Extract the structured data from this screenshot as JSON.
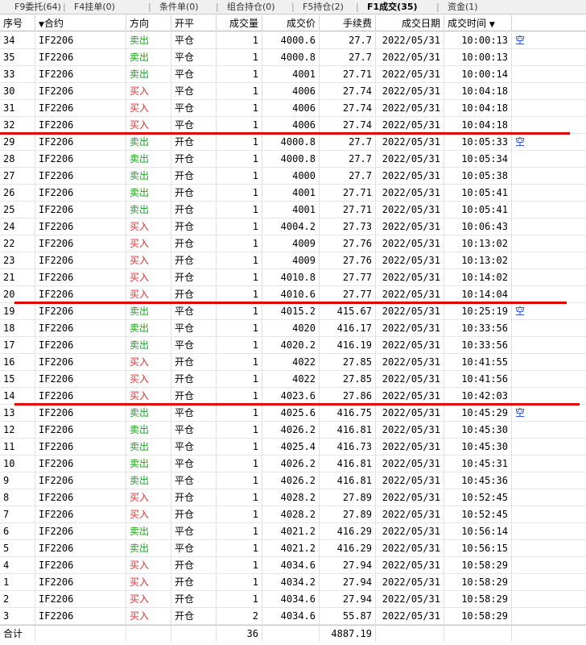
{
  "tabs": [
    {
      "label": "F9委托(64)"
    },
    {
      "label": "F4挂单(0)"
    },
    {
      "label": "条件单(0)"
    },
    {
      "label": "组合持仓(0)"
    },
    {
      "label": "F5持仓(2)"
    },
    {
      "label": "F1成交(35)",
      "active": true
    },
    {
      "label": "资金(1)"
    }
  ],
  "header": {
    "seq": "序号",
    "contract": "合约",
    "dir": "方向",
    "open": "开平",
    "qty": "成交量",
    "price": "成交价",
    "fee": "手续费",
    "date": "成交日期",
    "time": "成交时间"
  },
  "rows": [
    {
      "seq": "34",
      "contract": "IF2206",
      "dir": "卖出",
      "open": "平仓",
      "qty": "1",
      "price": "4000.6",
      "fee": "27.7",
      "date": "2022/05/31",
      "time": "10:00:13",
      "note": "空"
    },
    {
      "seq": "35",
      "contract": "IF2206",
      "dir": "卖出",
      "open": "平仓",
      "qty": "1",
      "price": "4000.8",
      "fee": "27.7",
      "date": "2022/05/31",
      "time": "10:00:13",
      "note": ""
    },
    {
      "seq": "33",
      "contract": "IF2206",
      "dir": "卖出",
      "open": "平仓",
      "qty": "1",
      "price": "4001",
      "fee": "27.71",
      "date": "2022/05/31",
      "time": "10:00:14",
      "note": ""
    },
    {
      "seq": "30",
      "contract": "IF2206",
      "dir": "买入",
      "open": "平仓",
      "qty": "1",
      "price": "4006",
      "fee": "27.74",
      "date": "2022/05/31",
      "time": "10:04:18",
      "note": ""
    },
    {
      "seq": "31",
      "contract": "IF2206",
      "dir": "买入",
      "open": "平仓",
      "qty": "1",
      "price": "4006",
      "fee": "27.74",
      "date": "2022/05/31",
      "time": "10:04:18",
      "note": ""
    },
    {
      "seq": "32",
      "contract": "IF2206",
      "dir": "买入",
      "open": "平仓",
      "qty": "1",
      "price": "4006",
      "fee": "27.74",
      "date": "2022/05/31",
      "time": "10:04:18",
      "note": ""
    },
    {
      "seq": "29",
      "contract": "IF2206",
      "dir": "卖出",
      "open": "开仓",
      "qty": "1",
      "price": "4000.8",
      "fee": "27.7",
      "date": "2022/05/31",
      "time": "10:05:33",
      "note": "空"
    },
    {
      "seq": "28",
      "contract": "IF2206",
      "dir": "卖出",
      "open": "开仓",
      "qty": "1",
      "price": "4000.8",
      "fee": "27.7",
      "date": "2022/05/31",
      "time": "10:05:34",
      "note": ""
    },
    {
      "seq": "27",
      "contract": "IF2206",
      "dir": "卖出",
      "open": "开仓",
      "qty": "1",
      "price": "4000",
      "fee": "27.7",
      "date": "2022/05/31",
      "time": "10:05:38",
      "note": ""
    },
    {
      "seq": "26",
      "contract": "IF2206",
      "dir": "卖出",
      "open": "开仓",
      "qty": "1",
      "price": "4001",
      "fee": "27.71",
      "date": "2022/05/31",
      "time": "10:05:41",
      "note": ""
    },
    {
      "seq": "25",
      "contract": "IF2206",
      "dir": "卖出",
      "open": "开仓",
      "qty": "1",
      "price": "4001",
      "fee": "27.71",
      "date": "2022/05/31",
      "time": "10:05:41",
      "note": ""
    },
    {
      "seq": "24",
      "contract": "IF2206",
      "dir": "买入",
      "open": "开仓",
      "qty": "1",
      "price": "4004.2",
      "fee": "27.73",
      "date": "2022/05/31",
      "time": "10:06:43",
      "note": ""
    },
    {
      "seq": "22",
      "contract": "IF2206",
      "dir": "买入",
      "open": "开仓",
      "qty": "1",
      "price": "4009",
      "fee": "27.76",
      "date": "2022/05/31",
      "time": "10:13:02",
      "note": ""
    },
    {
      "seq": "23",
      "contract": "IF2206",
      "dir": "买入",
      "open": "开仓",
      "qty": "1",
      "price": "4009",
      "fee": "27.76",
      "date": "2022/05/31",
      "time": "10:13:02",
      "note": ""
    },
    {
      "seq": "21",
      "contract": "IF2206",
      "dir": "买入",
      "open": "开仓",
      "qty": "1",
      "price": "4010.8",
      "fee": "27.77",
      "date": "2022/05/31",
      "time": "10:14:02",
      "note": ""
    },
    {
      "seq": "20",
      "contract": "IF2206",
      "dir": "买入",
      "open": "开仓",
      "qty": "1",
      "price": "4010.6",
      "fee": "27.77",
      "date": "2022/05/31",
      "time": "10:14:04",
      "note": ""
    },
    {
      "seq": "19",
      "contract": "IF2206",
      "dir": "卖出",
      "open": "平仓",
      "qty": "1",
      "price": "4015.2",
      "fee": "415.67",
      "date": "2022/05/31",
      "time": "10:25:19",
      "note": "空"
    },
    {
      "seq": "18",
      "contract": "IF2206",
      "dir": "卖出",
      "open": "平仓",
      "qty": "1",
      "price": "4020",
      "fee": "416.17",
      "date": "2022/05/31",
      "time": "10:33:56",
      "note": ""
    },
    {
      "seq": "17",
      "contract": "IF2206",
      "dir": "卖出",
      "open": "平仓",
      "qty": "1",
      "price": "4020.2",
      "fee": "416.19",
      "date": "2022/05/31",
      "time": "10:33:56",
      "note": ""
    },
    {
      "seq": "16",
      "contract": "IF2206",
      "dir": "买入",
      "open": "开仓",
      "qty": "1",
      "price": "4022",
      "fee": "27.85",
      "date": "2022/05/31",
      "time": "10:41:55",
      "note": ""
    },
    {
      "seq": "15",
      "contract": "IF2206",
      "dir": "买入",
      "open": "开仓",
      "qty": "1",
      "price": "4022",
      "fee": "27.85",
      "date": "2022/05/31",
      "time": "10:41:56",
      "note": ""
    },
    {
      "seq": "14",
      "contract": "IF2206",
      "dir": "买入",
      "open": "开仓",
      "qty": "1",
      "price": "4023.6",
      "fee": "27.86",
      "date": "2022/05/31",
      "time": "10:42:03",
      "note": ""
    },
    {
      "seq": "13",
      "contract": "IF2206",
      "dir": "卖出",
      "open": "平仓",
      "qty": "1",
      "price": "4025.6",
      "fee": "416.75",
      "date": "2022/05/31",
      "time": "10:45:29",
      "note": "空"
    },
    {
      "seq": "12",
      "contract": "IF2206",
      "dir": "卖出",
      "open": "平仓",
      "qty": "1",
      "price": "4026.2",
      "fee": "416.81",
      "date": "2022/05/31",
      "time": "10:45:30",
      "note": ""
    },
    {
      "seq": "11",
      "contract": "IF2206",
      "dir": "卖出",
      "open": "平仓",
      "qty": "1",
      "price": "4025.4",
      "fee": "416.73",
      "date": "2022/05/31",
      "time": "10:45:30",
      "note": ""
    },
    {
      "seq": "10",
      "contract": "IF2206",
      "dir": "卖出",
      "open": "平仓",
      "qty": "1",
      "price": "4026.2",
      "fee": "416.81",
      "date": "2022/05/31",
      "time": "10:45:31",
      "note": ""
    },
    {
      "seq": "9",
      "contract": "IF2206",
      "dir": "卖出",
      "open": "平仓",
      "qty": "1",
      "price": "4026.2",
      "fee": "416.81",
      "date": "2022/05/31",
      "time": "10:45:36",
      "note": ""
    },
    {
      "seq": "8",
      "contract": "IF2206",
      "dir": "买入",
      "open": "开仓",
      "qty": "1",
      "price": "4028.2",
      "fee": "27.89",
      "date": "2022/05/31",
      "time": "10:52:45",
      "note": ""
    },
    {
      "seq": "7",
      "contract": "IF2206",
      "dir": "买入",
      "open": "开仓",
      "qty": "1",
      "price": "4028.2",
      "fee": "27.89",
      "date": "2022/05/31",
      "time": "10:52:45",
      "note": ""
    },
    {
      "seq": "6",
      "contract": "IF2206",
      "dir": "卖出",
      "open": "平仓",
      "qty": "1",
      "price": "4021.2",
      "fee": "416.29",
      "date": "2022/05/31",
      "time": "10:56:14",
      "note": ""
    },
    {
      "seq": "5",
      "contract": "IF2206",
      "dir": "卖出",
      "open": "平仓",
      "qty": "1",
      "price": "4021.2",
      "fee": "416.29",
      "date": "2022/05/31",
      "time": "10:56:15",
      "note": ""
    },
    {
      "seq": "4",
      "contract": "IF2206",
      "dir": "买入",
      "open": "开仓",
      "qty": "1",
      "price": "4034.6",
      "fee": "27.94",
      "date": "2022/05/31",
      "time": "10:58:29",
      "note": ""
    },
    {
      "seq": "1",
      "contract": "IF2206",
      "dir": "买入",
      "open": "开仓",
      "qty": "1",
      "price": "4034.2",
      "fee": "27.94",
      "date": "2022/05/31",
      "time": "10:58:29",
      "note": ""
    },
    {
      "seq": "2",
      "contract": "IF2206",
      "dir": "买入",
      "open": "开仓",
      "qty": "1",
      "price": "4034.6",
      "fee": "27.94",
      "date": "2022/05/31",
      "time": "10:58:29",
      "note": ""
    },
    {
      "seq": "3",
      "contract": "IF2206",
      "dir": "买入",
      "open": "开仓",
      "qty": "2",
      "price": "4034.6",
      "fee": "55.87",
      "date": "2022/05/31",
      "time": "10:58:29",
      "note": ""
    }
  ],
  "total": {
    "label": "合计",
    "qty": "36",
    "fee": "4887.19"
  },
  "colors": {
    "buy": "#e53030",
    "sell": "#1fa31f",
    "annotation_line": "#e00000",
    "note": "#1a3fd6"
  }
}
